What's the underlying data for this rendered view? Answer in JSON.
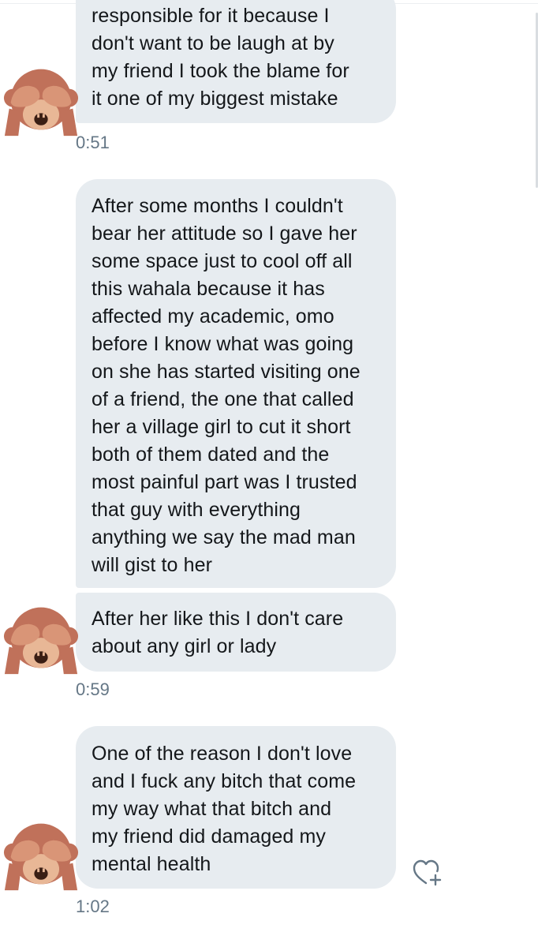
{
  "messages": [
    {
      "text": "responsible for it because I\ndon't want to be laugh at by\nmy friend I took the blame for\nit one of my biggest mistake",
      "time": "0:51"
    },
    {
      "text": "After some months I couldn't\nbear her attitude so I gave her\nsome space just to cool off all\nthis wahala because it has\naffected my academic, omo\nbefore I know what was going\non she has started visiting one\nof a friend, the one that called\nher a village girl to cut it short\nboth of them dated and the\nmost painful part was I trusted\nthat guy with everything\nanything we say the mad man\nwill gist to her",
      "time": ""
    },
    {
      "text": "After her like this I don't care\nabout any girl or lady",
      "time": "0:59"
    },
    {
      "text": "One of the reason I don't love\nand I fuck any bitch that come\nmy way what that bitch and\nmy friend did damaged my\nmental health",
      "time": "1:02"
    }
  ],
  "avatar_icon": "see-no-evil-monkey-icon",
  "react_icon": "heart-plus-icon",
  "colors": {
    "bubble_bg": "#e7ecf0",
    "text": "#14171a",
    "timestamp": "#657786",
    "monkey_fur": "#c0715a",
    "monkey_face": "#e8b796",
    "monkey_mouth": "#3a1e14"
  }
}
